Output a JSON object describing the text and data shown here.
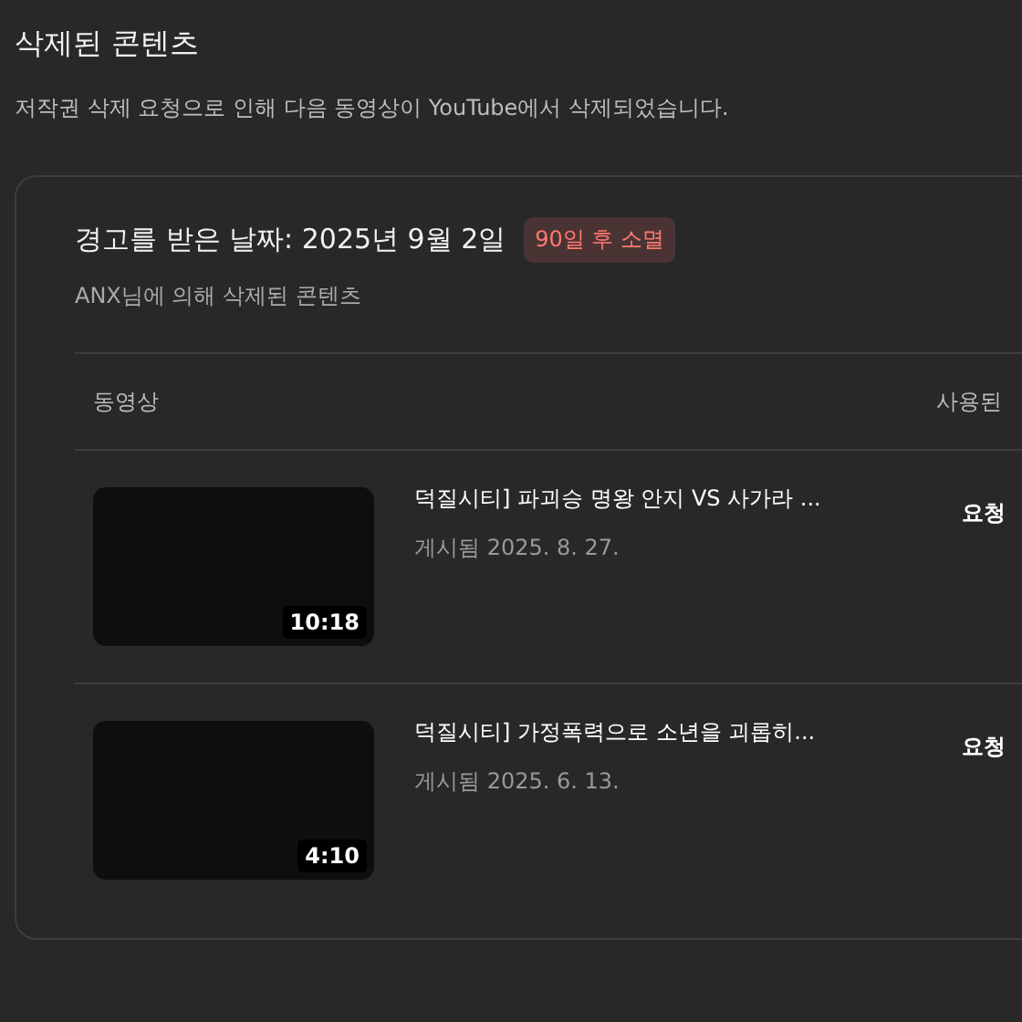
{
  "page": {
    "title": "삭제된 콘텐츠",
    "description": "저작권 삭제 요청으로 인해 다음 동영상이 YouTube에서 삭제되었습니다."
  },
  "strike": {
    "heading": "경고를 받은 날짜: 2025년 9월 2일",
    "badge": "90일 후 소멸",
    "subtitle": "ANX님에 의해 삭제된 콘텐츠"
  },
  "table": {
    "columns": [
      "동영상",
      "사용된"
    ],
    "rows": [
      {
        "title": "덕질시티] 파괴승 명왕 안지 VS 사가라 ...",
        "posted": "게시됨 2025. 8. 27.",
        "duration": "10:18",
        "column_2": "요청"
      },
      {
        "title": "덕질시티] 가정폭력으로 소년을 괴롭히...",
        "posted": "게시됨 2025. 6. 13.",
        "duration": "4:10",
        "column_2": "요청"
      }
    ]
  }
}
